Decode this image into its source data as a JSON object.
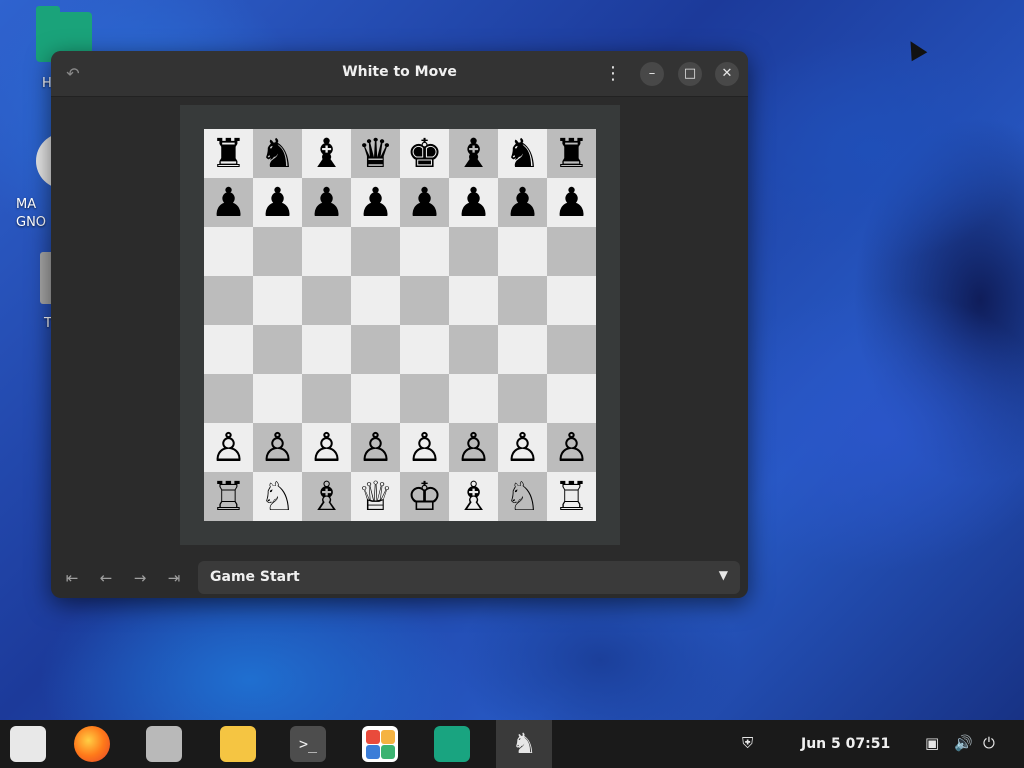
{
  "desktop": {
    "icons": [
      {
        "label": "H",
        "icon": "home-folder-icon"
      },
      {
        "label": "MA\nGNO",
        "icon": "disc-icon"
      },
      {
        "label": "T",
        "icon": "trash-icon"
      }
    ]
  },
  "window": {
    "title": "White to Move",
    "undo_icon": "↶",
    "menu_icon": "⋮",
    "min_icon": "–",
    "max_icon": "□",
    "close_icon": "✕"
  },
  "board": {
    "rows": [
      [
        "♜",
        "♞",
        "♝",
        "♛",
        "♚",
        "♝",
        "♞",
        "♜"
      ],
      [
        "♟",
        "♟",
        "♟",
        "♟",
        "♟",
        "♟",
        "♟",
        "♟"
      ],
      [
        "",
        "",
        "",
        "",
        "",
        "",
        "",
        ""
      ],
      [
        "",
        "",
        "",
        "",
        "",
        "",
        "",
        ""
      ],
      [
        "",
        "",
        "",
        "",
        "",
        "",
        "",
        ""
      ],
      [
        "",
        "",
        "",
        "",
        "",
        "",
        "",
        ""
      ],
      [
        "♙",
        "♙",
        "♙",
        "♙",
        "♙",
        "♙",
        "♙",
        "♙"
      ],
      [
        "♖",
        "♘",
        "♗",
        "♕",
        "♔",
        "♗",
        "♘",
        "♖"
      ]
    ]
  },
  "controls": {
    "first_icon": "⇤",
    "prev_icon": "←",
    "next_icon": "→",
    "last_icon": "⇥",
    "history_label": "Game Start",
    "dropdown_icon": "▼"
  },
  "taskbar": {
    "date": "Jun 5",
    "time": "07:51",
    "terminal_glyph": ">_",
    "chess_glyph": "♞",
    "shield_icon": "⛨",
    "network_icon": "▣",
    "volume_icon": "🔊",
    "power_icon": "⏻"
  }
}
